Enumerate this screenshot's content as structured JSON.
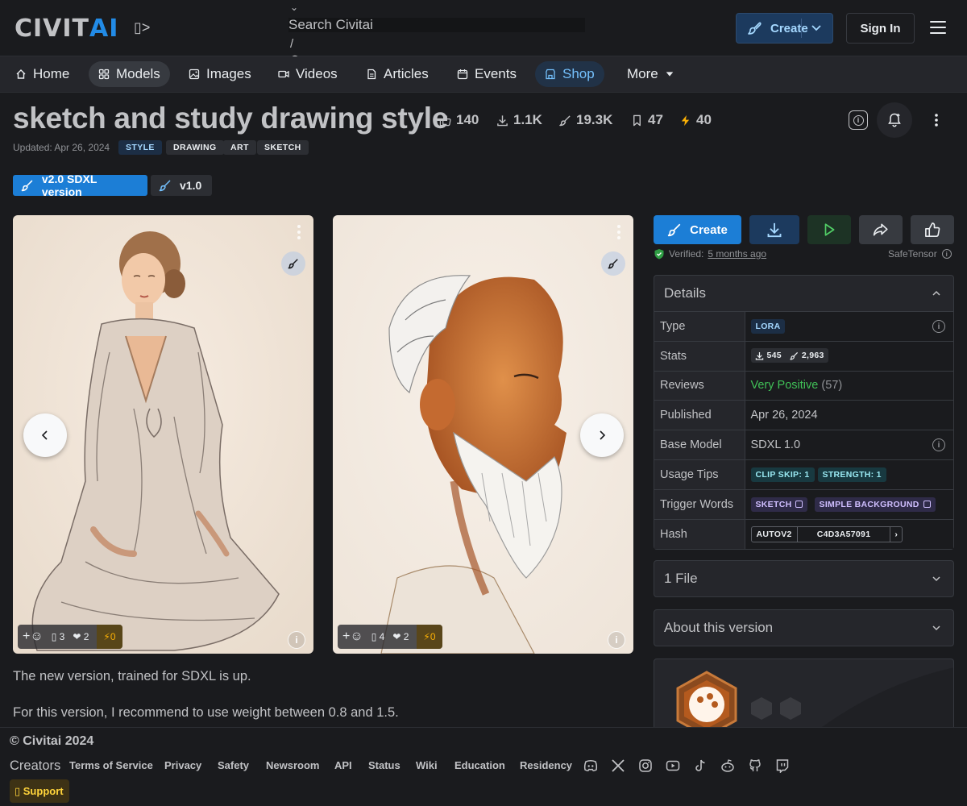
{
  "header": {
    "logo_civ": "CIVIT",
    "logo_ai": "AI",
    "logo_side_glyph": "▯>",
    "search_caret": "⌄",
    "search_placeholder": "Search Civitai",
    "search_shortcut": "/",
    "create_label": "Create",
    "signin_label": "Sign In"
  },
  "nav": {
    "items": [
      {
        "label": "Home",
        "icon": "home-icon"
      },
      {
        "label": "Models",
        "icon": "grid-icon"
      },
      {
        "label": "Images",
        "icon": "image-icon"
      },
      {
        "label": "Videos",
        "icon": "video-icon"
      },
      {
        "label": "Articles",
        "icon": "article-icon"
      },
      {
        "label": "Events",
        "icon": "calendar-icon"
      },
      {
        "label": "Shop",
        "icon": "shop-icon"
      },
      {
        "label": "More",
        "icon": "caret-down-icon"
      }
    ]
  },
  "model": {
    "title": "sketch and study drawing style",
    "stats": {
      "likes": "140",
      "downloads": "1.1K",
      "generations": "19.3K",
      "bookmarks": "47",
      "buzz": "40"
    },
    "updated": "Updated: Apr 26, 2024",
    "tags": [
      "STYLE",
      "DRAWING",
      "ART",
      "SKETCH"
    ],
    "versions": [
      "v2.0 SDXL version",
      "v1.0"
    ],
    "description": [
      "The new version, trained for SDXL is up.",
      "For this version, I recommend to use weight between 0.8 and 1.5."
    ]
  },
  "gallery": [
    {
      "name": "woman seated sketch",
      "comments": "3",
      "hearts": "2",
      "buzz": "0"
    },
    {
      "name": "old man watercolor portrait",
      "comments": "4",
      "hearts": "2",
      "buzz": "0"
    }
  ],
  "actions": {
    "create_label": "Create",
    "verified_prefix": "Verified:",
    "verified_when": "5 months ago",
    "format": "SafeTensor"
  },
  "details": {
    "heading": "Details",
    "rows": {
      "type_label": "Type",
      "type_value": "LORA",
      "stats_label": "Stats",
      "stats_downloads": "545",
      "stats_generations": "2,963",
      "reviews_label": "Reviews",
      "reviews_value": "Very Positive",
      "reviews_count": "(57)",
      "published_label": "Published",
      "published_value": "Apr 26, 2024",
      "base_label": "Base Model",
      "base_value": "SDXL 1.0",
      "tips_label": "Usage Tips",
      "tip1": "CLIP SKIP: 1",
      "tip2": "STRENGTH: 1",
      "trigger_label": "Trigger Words",
      "trigger1": "SKETCH",
      "trigger2": "SIMPLE BACKGROUND",
      "hash_label": "Hash",
      "hash_algo": "AUTOV2",
      "hash_value": "C4D3A57091"
    }
  },
  "files_heading": "1 File",
  "about_heading": "About this version",
  "footer": {
    "copyright": "© Civitai 2024",
    "creators": "Creators",
    "links": [
      "Terms of Service",
      "Privacy",
      "Safety",
      "Newsroom",
      "API",
      "Status",
      "Wiki",
      "Education",
      "Residency"
    ],
    "support": "▯ Support"
  },
  "colors": {
    "accent": "#228be6",
    "background": "#1a1b1e",
    "panel": "#25262b",
    "positive": "#40c057",
    "buzz": "#fab005"
  }
}
